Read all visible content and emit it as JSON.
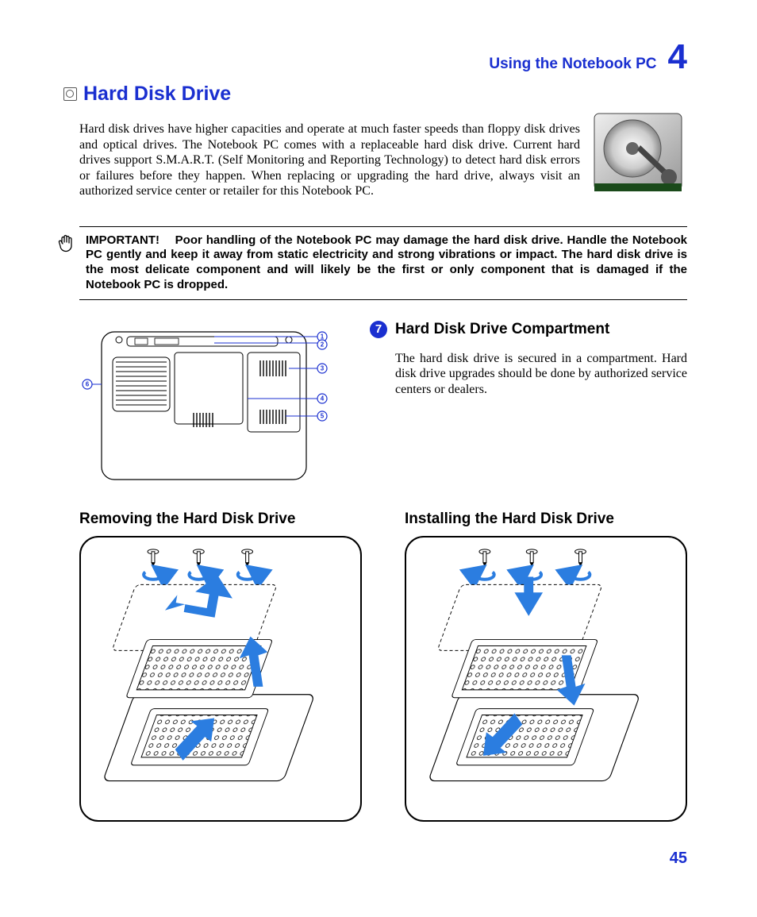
{
  "header": {
    "chapter_title": "Using the Notebook PC",
    "chapter_number": "4"
  },
  "section": {
    "title": "Hard Disk Drive",
    "intro": "Hard disk drives have higher capacities and operate at much faster speeds than floppy disk drives and optical drives. The Notebook PC comes with a replaceable hard disk drive. Current hard drives support S.M.A.R.T. (Self Monitoring and Reporting Technology) to detect hard disk errors or failures before they happen. When replacing or upgrading the hard drive, always visit an authorized service center or retailer for this Notebook PC."
  },
  "important_note": {
    "label": "IMPORTANT!",
    "body": "Poor handling of the Notebook PC may damage the hard disk drive. Handle the Notebook PC gently and keep it away from static electricity and strong vibrations or impact. The hard disk drive is the most delicate component and will likely be the first or only component that is damaged if the Notebook PC is dropped."
  },
  "compartment": {
    "badge": "7",
    "title": "Hard Disk Drive Compartment",
    "body": "The hard disk drive is secured in a compartment. Hard disk drive upgrades should be done by authorized service centers or dealers."
  },
  "bottom_labels": [
    "1",
    "2",
    "3",
    "4",
    "5",
    "6"
  ],
  "procedures": {
    "remove": "Removing the Hard Disk Drive",
    "install": "Installing the Hard Disk Drive"
  },
  "page_number": "45"
}
